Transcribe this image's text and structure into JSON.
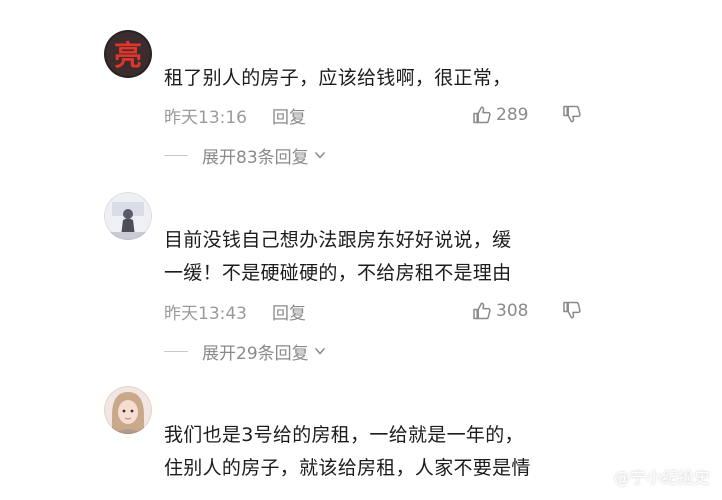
{
  "comments": [
    {
      "avatar_text": "亮",
      "lines": [
        "租了别人的房子，应该给钱啊，很正常，"
      ],
      "time": "昨天13:16",
      "reply_label": "回复",
      "likes": "289",
      "expand_label": "展开83条回复"
    },
    {
      "lines": [
        "目前没钱自己想办法跟房东好好说说，缓",
        "一缓！不是硬碰硬的，不给房租不是理由"
      ],
      "time": "昨天13:43",
      "reply_label": "回复",
      "likes": "308",
      "expand_label": "展开29条回复"
    },
    {
      "lines": [
        "我们也是3号给的房租，一给就是一年的，",
        "住别人的房子，就该给房租，人家不要是情"
      ]
    }
  ],
  "watermark": {
    "text": "@宁小纪捡史"
  },
  "colors": {
    "meta": "#9a9a9a",
    "text": "#1c1c1c"
  }
}
